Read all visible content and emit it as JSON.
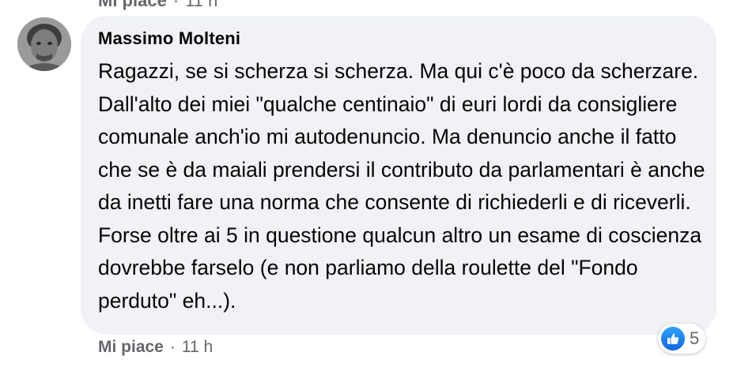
{
  "previous_comment": {
    "like_label": "Mi piace",
    "separator": "·",
    "time": "11 h"
  },
  "comment": {
    "author": "Massimo Molteni",
    "avatar_icon": "avatar-photo",
    "text": "Ragazzi, se si scherza si scherza. Ma qui c'è poco da scherzare. Dall'alto dei miei \"qualche centinaio\" di euri lordi da consigliere comunale anch'io mi autodenuncio. Ma denuncio anche il fatto che se è da maiali prendersi il contributo da parlamentari è anche da inetti fare una norma che consente di richiederli e di riceverli. Forse oltre ai 5 in questione qualcun altro un esame di coscienza dovrebbe farselo (e non parliamo della roulette del \"Fondo perduto\" eh...).",
    "bubble_color": "#f0f2f5"
  },
  "reactions": {
    "icon": "like-thumb-icon",
    "count": "5",
    "accent": "#1877f2"
  },
  "actions": {
    "like_label": "Mi piace",
    "separator": "·",
    "time": "11 h"
  }
}
